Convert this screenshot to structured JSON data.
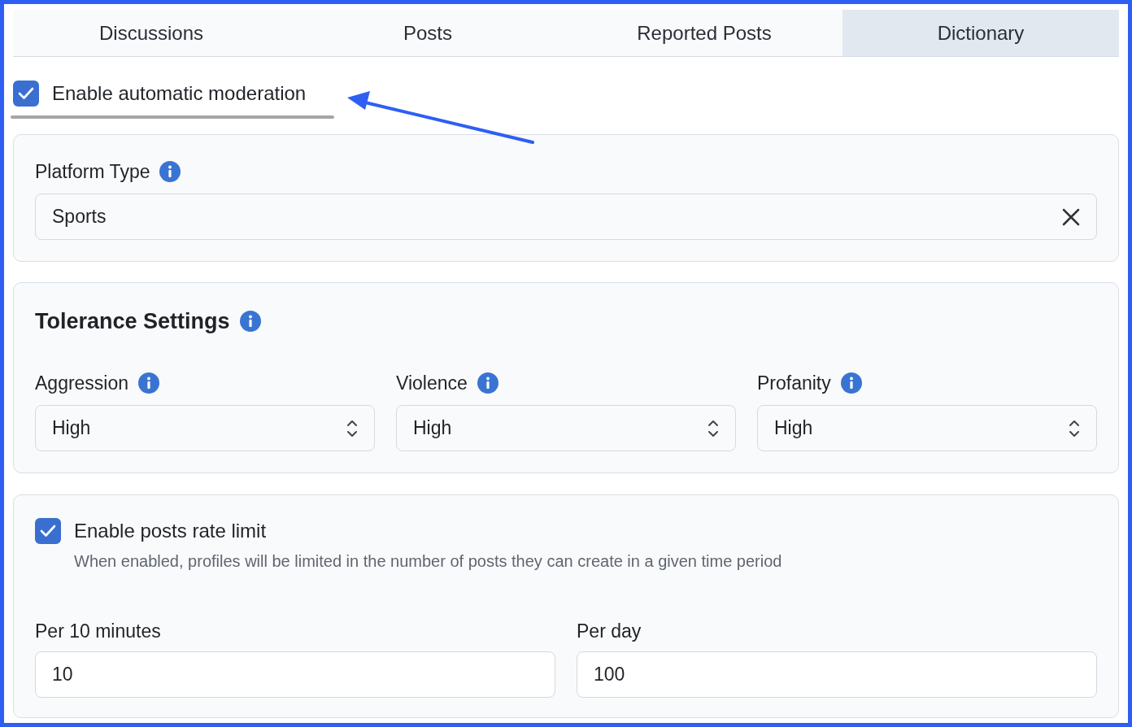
{
  "tabs": [
    {
      "label": "Discussions",
      "selected": false
    },
    {
      "label": "Posts",
      "selected": false
    },
    {
      "label": "Reported Posts",
      "selected": false
    },
    {
      "label": "Dictionary",
      "selected": true
    }
  ],
  "auto_moderation": {
    "label": "Enable automatic moderation",
    "checked": true
  },
  "platform_type": {
    "label": "Platform Type",
    "value": "Sports"
  },
  "tolerance": {
    "title": "Tolerance Settings",
    "fields": [
      {
        "label": "Aggression",
        "value": "High"
      },
      {
        "label": "Violence",
        "value": "High"
      },
      {
        "label": "Profanity",
        "value": "High"
      }
    ]
  },
  "rate_limit": {
    "label": "Enable posts rate limit",
    "checked": true,
    "description": "When enabled, profiles will be limited in the number of posts they can create in a given time period",
    "fields": [
      {
        "label": "Per 10 minutes",
        "value": "10"
      },
      {
        "label": "Per day",
        "value": "100"
      }
    ]
  }
}
